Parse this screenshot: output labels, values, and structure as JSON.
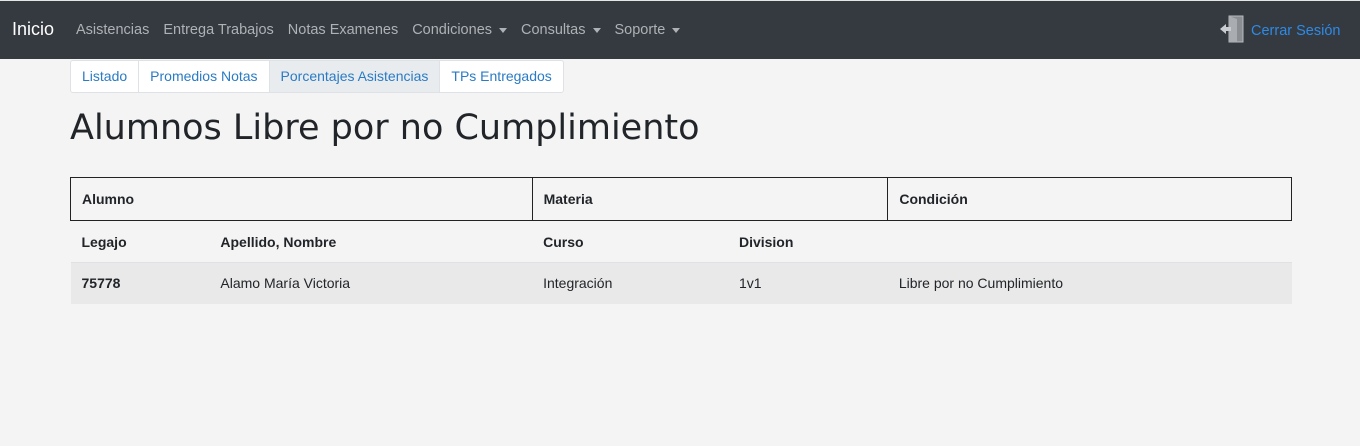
{
  "navbar": {
    "brand": "Inicio",
    "items": [
      {
        "label": "Asistencias",
        "dropdown": false
      },
      {
        "label": "Entrega Trabajos",
        "dropdown": false
      },
      {
        "label": "Notas Examenes",
        "dropdown": false
      },
      {
        "label": "Condiciones",
        "dropdown": true
      },
      {
        "label": "Consultas",
        "dropdown": true
      },
      {
        "label": "Soporte",
        "dropdown": true
      }
    ],
    "logout": {
      "label": "Cerrar Sesión",
      "icon": "exit-door-icon"
    }
  },
  "tabs": [
    "Listado",
    "Promedios Notas",
    "Porcentajes Asistencias",
    "TPs Entregados"
  ],
  "active_tab": "Porcentajes Asistencias",
  "page_title": "Alumnos Libre por no Cumplimiento",
  "table": {
    "groups": [
      "Alumno",
      "Materia",
      "Condición"
    ],
    "columns": [
      "Legajo",
      "Apellido, Nombre",
      "Curso",
      "Division",
      ""
    ],
    "rows": [
      [
        "75778",
        "Alamo María Victoria",
        "Integración",
        "1v1",
        "Libre por no Cumplimiento"
      ]
    ]
  },
  "colors": {
    "navbar_bg": "#343a40",
    "link": "#2a7bc4",
    "accent": "#2e8ae6"
  }
}
